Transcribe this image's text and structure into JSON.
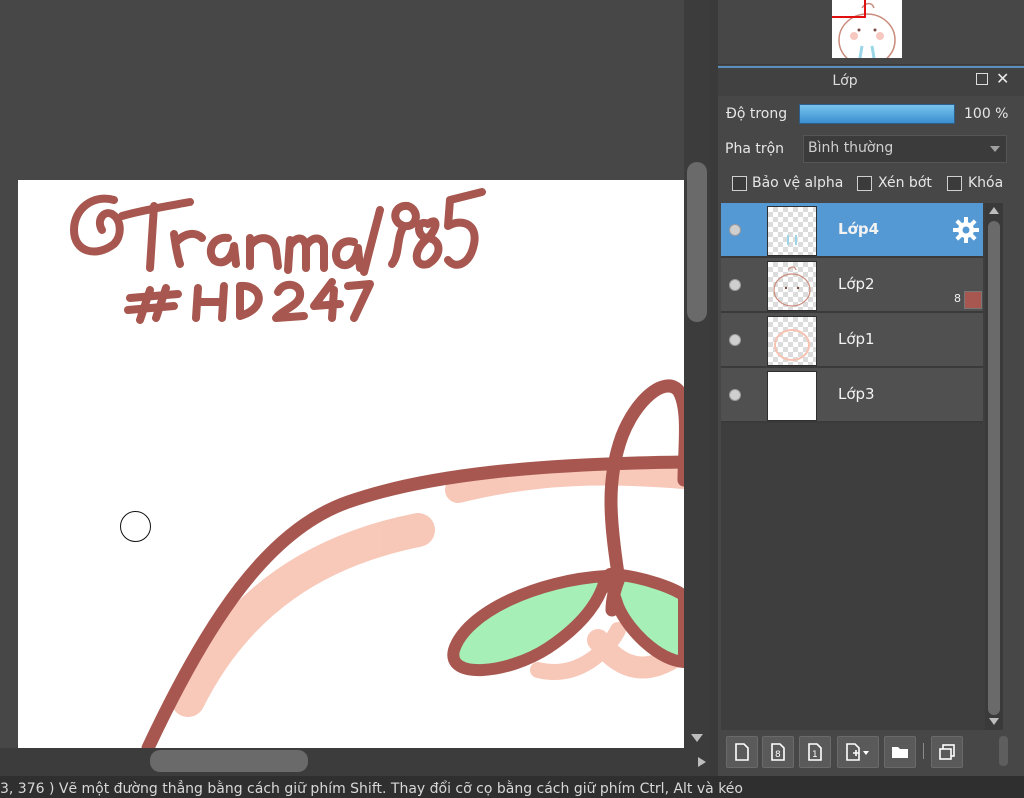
{
  "canvas": {
    "signature_text": "@Trânma1985 #HD247",
    "cursor": "brush-circle-cursor"
  },
  "layers_panel": {
    "title": "Lớp",
    "opacity_label": "Độ trong",
    "opacity_value": "100 %",
    "opacity_fraction": 1.0,
    "blend_label": "Pha trộn",
    "blend_value": "Bình thường",
    "checkboxes": [
      {
        "label": "Bảo vệ alpha",
        "checked": false
      },
      {
        "label": "Xén bớt",
        "checked": false
      },
      {
        "label": "Khóa",
        "checked": false
      }
    ],
    "layers": [
      {
        "name": "Lớp4",
        "selected": true,
        "visible": true,
        "icon": "gear-icon"
      },
      {
        "name": "Lớp2",
        "selected": false,
        "visible": true,
        "badge": "8",
        "swatch_color": "#a7574f"
      },
      {
        "name": "Lớp1",
        "selected": false,
        "visible": true
      },
      {
        "name": "Lớp3",
        "selected": false,
        "visible": true
      }
    ],
    "toolbar_icons": [
      "new-layer-icon",
      "new-8bit-layer-icon",
      "new-1bit-layer-icon",
      "add-layer-menu-icon",
      "new-folder-icon",
      "duplicate-layer-icon"
    ]
  },
  "colors": {
    "accent": "#5599d4",
    "line_art": "#a7574f",
    "blush": "#f7c2b1",
    "leaf": "#a6efb6"
  },
  "status": {
    "text": "3, 376 )  Vẽ một đường thẳng bằng cách giữ phím Shift. Thay đổi cỡ cọ bằng cách giữ phím Ctrl, Alt và kéo"
  }
}
